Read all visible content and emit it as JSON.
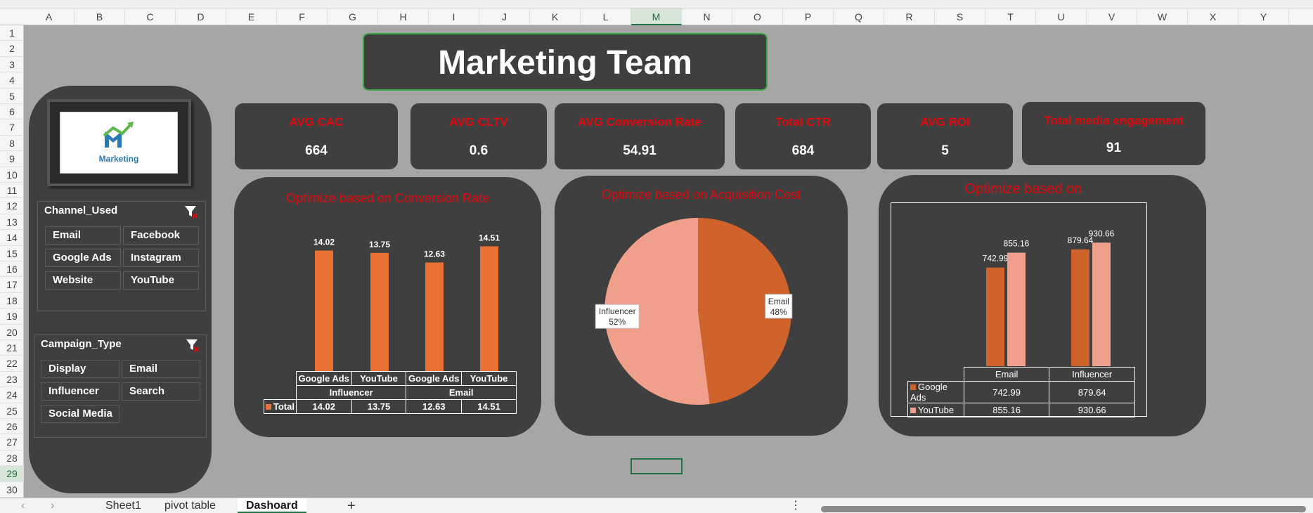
{
  "sheet": {
    "columns": [
      "A",
      "B",
      "C",
      "D",
      "E",
      "F",
      "G",
      "H",
      "I",
      "J",
      "K",
      "L",
      "M",
      "N",
      "O",
      "P",
      "Q",
      "R",
      "S",
      "T",
      "U",
      "V",
      "W",
      "X",
      "Y"
    ],
    "selected_column": "M",
    "rows": [
      "1",
      "2",
      "3",
      "4",
      "5",
      "6",
      "7",
      "8",
      "9",
      "10",
      "11",
      "12",
      "13",
      "14",
      "15",
      "16",
      "17",
      "18",
      "19",
      "20",
      "21",
      "22",
      "23",
      "24",
      "25",
      "26",
      "27",
      "28",
      "29",
      "30"
    ],
    "selected_row": "29"
  },
  "dashboard": {
    "title": "Marketing Team",
    "logo_text": "Marketing"
  },
  "slicers": {
    "channel": {
      "title": "Channel_Used",
      "items": [
        "Email",
        "Facebook",
        "Google Ads",
        "Instagram",
        "Website",
        "YouTube"
      ]
    },
    "campaign": {
      "title": "Campaign_Type",
      "items": [
        "Display",
        "Email",
        "Influencer",
        "Search",
        "Social Media"
      ]
    }
  },
  "kpis": [
    {
      "label": "AVG CAC",
      "value": "664"
    },
    {
      "label": "AVG CLTV",
      "value": "0.6"
    },
    {
      "label": "AVG Conversion Rate",
      "value": "54.91"
    },
    {
      "label": "Total CTR",
      "value": "684"
    },
    {
      "label": "AVG ROI",
      "value": "5"
    },
    {
      "label": "Total media engagement",
      "value": "91"
    }
  ],
  "chart_data": [
    {
      "type": "bar",
      "title": "Optimize based on Conversion Rate",
      "categories": [
        "Google Ads",
        "YouTube",
        "Google Ads",
        "YouTube"
      ],
      "groups": [
        "Influencer",
        "Email"
      ],
      "series": [
        {
          "name": "Total",
          "values": [
            14.02,
            13.75,
            12.63,
            14.51
          ]
        }
      ],
      "value_labels": [
        "14.02",
        "13.75",
        "12.63",
        "14.51"
      ],
      "ylim": [
        0,
        16
      ],
      "color": "#e97132",
      "data_table": true
    },
    {
      "type": "pie",
      "title": "Optimize based on Acquisition Cost",
      "slices": [
        {
          "label": "Email",
          "percent_label": "48%",
          "value": 48,
          "color": "#d0632b"
        },
        {
          "label": "Influencer",
          "percent_label": "52%",
          "value": 52,
          "color": "#f0a08a"
        }
      ]
    },
    {
      "type": "bar",
      "title": "Optimize based on",
      "categories": [
        "Email",
        "Influencer"
      ],
      "series": [
        {
          "name": "Google Ads",
          "values": [
            742.99,
            879.64
          ],
          "labels": [
            "742.99",
            "879.64"
          ],
          "color": "#d0632b"
        },
        {
          "name": "YouTube",
          "values": [
            855.16,
            930.66
          ],
          "labels": [
            "855.16",
            "930.66"
          ],
          "color": "#f0a08a"
        }
      ],
      "ylim": [
        0,
        1000
      ],
      "data_table": true
    }
  ],
  "tabs": {
    "nav_prev": "‹",
    "nav_next": "›",
    "sheet1": "Sheet1",
    "pivot": "pivot table",
    "dashboard": "Dashoard",
    "add": "+",
    "more": "⋮"
  }
}
